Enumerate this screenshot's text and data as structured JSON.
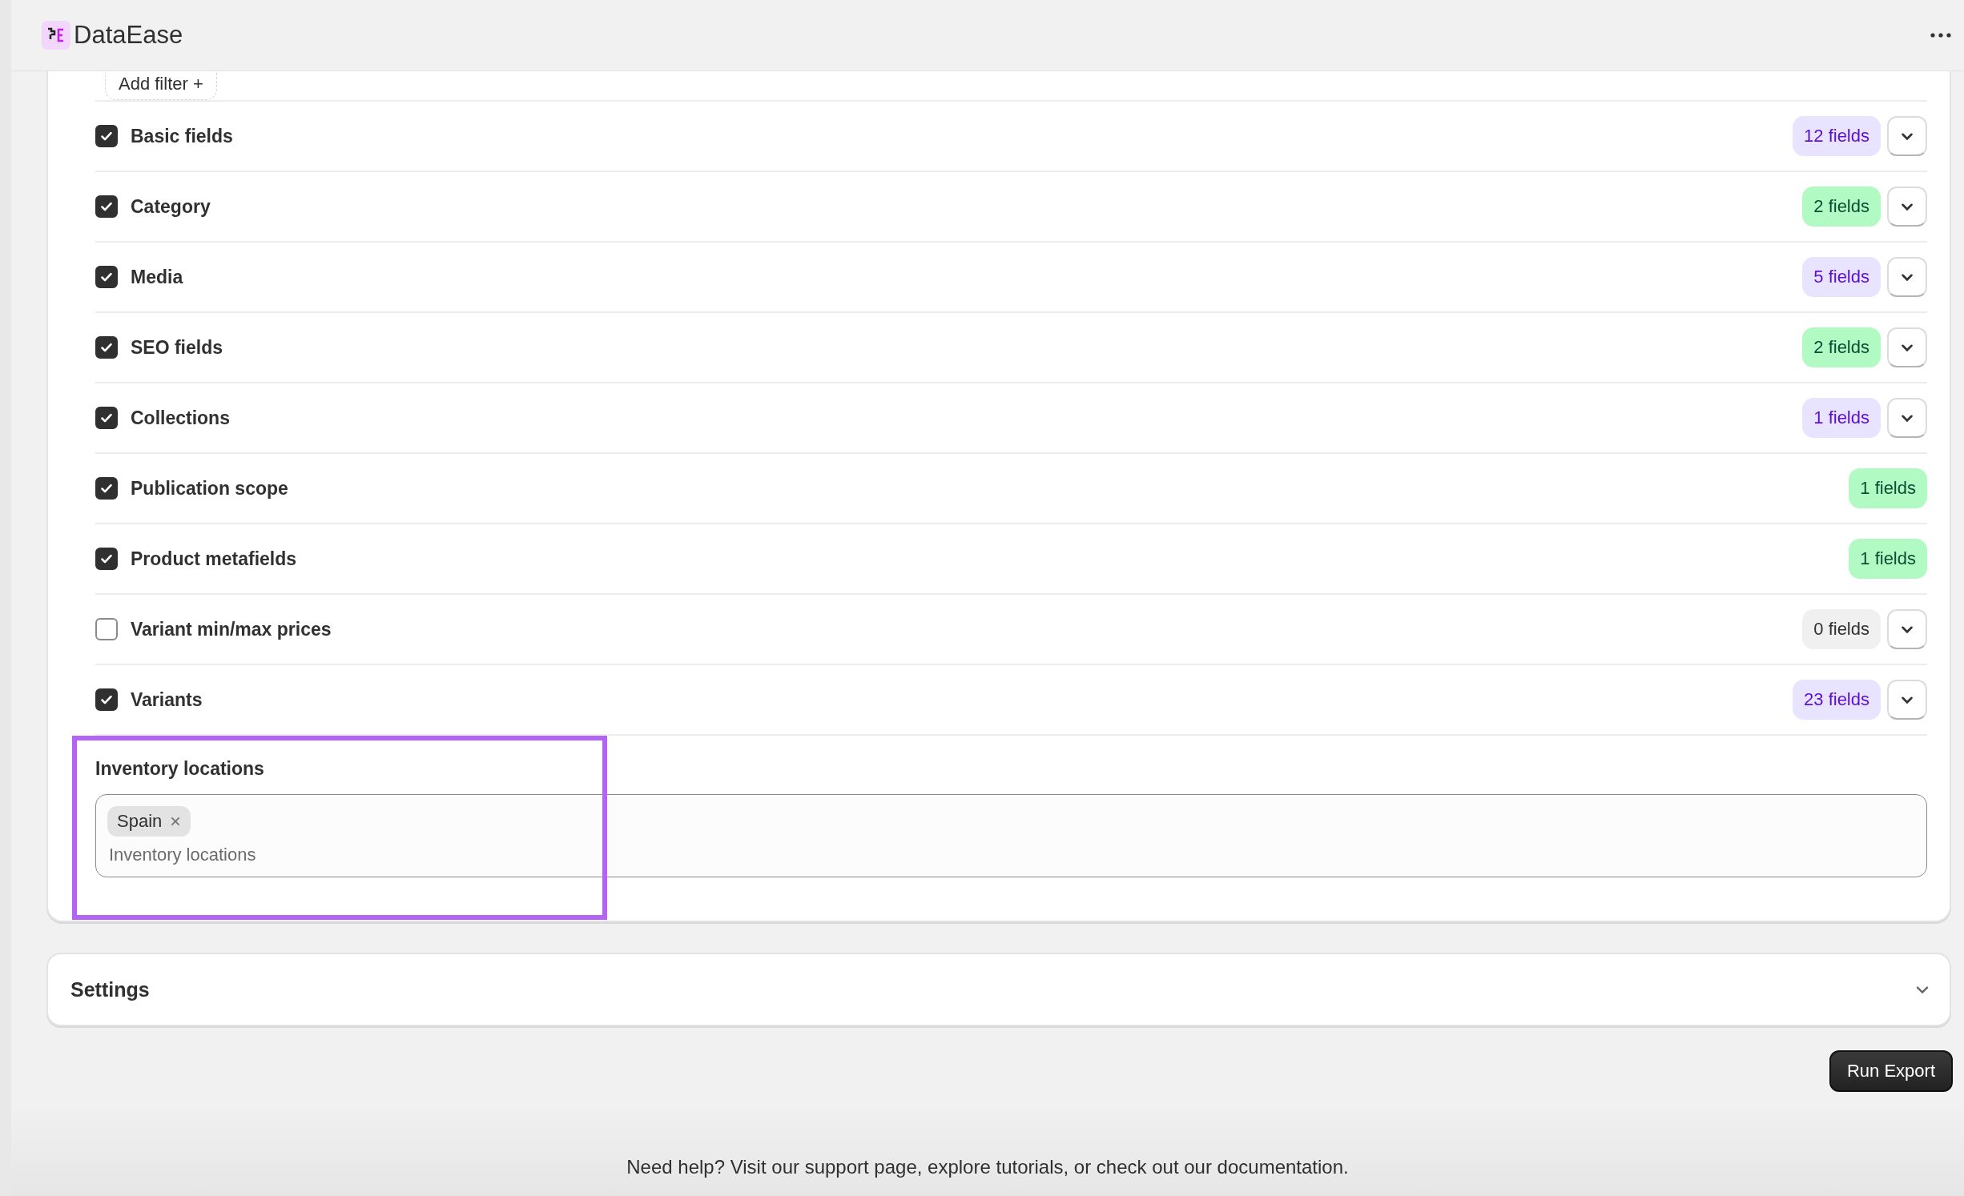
{
  "app": {
    "title": "DataEase"
  },
  "filter": {
    "label": "Add filter +"
  },
  "groups": [
    {
      "label": "Basic fields",
      "checked": true,
      "badge": "12 fields",
      "color": "#e8e3ff",
      "expandable": true
    },
    {
      "label": "Category",
      "checked": true,
      "badge": "2 fields",
      "color": "#b1fac3",
      "expandable": true
    },
    {
      "label": "Media",
      "checked": true,
      "badge": "5 fields",
      "color": "#e8e3ff",
      "expandable": true
    },
    {
      "label": "SEO fields",
      "checked": true,
      "badge": "2 fields",
      "color": "#b1fac3",
      "expandable": true
    },
    {
      "label": "Collections",
      "checked": true,
      "badge": "1 fields",
      "color": "#e8e3ff",
      "expandable": true
    },
    {
      "label": "Publication scope",
      "checked": true,
      "badge": "1 fields",
      "color": "#b1fac3",
      "expandable": false
    },
    {
      "label": "Product metafields",
      "checked": true,
      "badge": "1 fields",
      "color": "#b1fac3",
      "expandable": false
    },
    {
      "label": "Variant min/max prices",
      "checked": false,
      "badge": "0 fields",
      "color": "#f0f0f0",
      "expandable": true
    },
    {
      "label": "Variants",
      "checked": true,
      "badge": "23 fields",
      "color": "#e8e3ff",
      "expandable": true
    }
  ],
  "inventory": {
    "label": "Inventory locations",
    "tags": [
      "Spain"
    ],
    "placeholder": "Inventory locations",
    "highlighted": true
  },
  "settings": {
    "title": "Settings",
    "expanded": false
  },
  "run_button": "Run Export",
  "footer": "Need help? Visit our support page, explore tutorials, or check out our documentation."
}
